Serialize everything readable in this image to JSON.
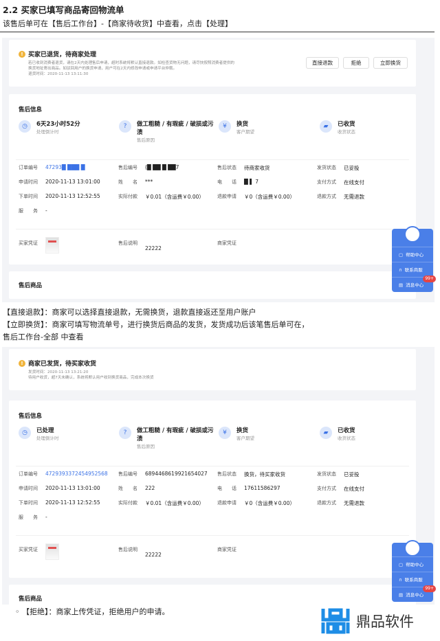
{
  "doc": {
    "heading": "2.2 买家已填写商品寄回物流单",
    "intro": "该售后单可在【售后工作台】-【商家待收货】中查看，点击【处理】",
    "note1": "【直接退款】：商家可以选择直接退款，无需换货，退款直接返还至用户账户",
    "note2": "【立即换货】：商家可填写物流单号，进行换货后商品的发货，发货成功后该笔售后单可在，",
    "note3": "售后工作台-全部  中查看",
    "note4": "◦ 【拒绝】：商家上传凭证，拒绝用户的申请。"
  },
  "logo": {
    "text": "鼎品软件",
    "color": "#1e8de6"
  },
  "accent": "#3b72e6",
  "panels": [
    {
      "alert": {
        "title": "买家已退货，待商家处理",
        "lines": [
          "若已收到消费者退货，请在2天内处理售后申请，超时系统将默认直接退款。如检查货物无问题，请尽快按照消费者提供的",
          "换货地址寄出商品。如驳回用户的换货申请，用户可在2天内修改申请或申请平台仲裁。",
          "退货时间：2020-11-13 13:11:30"
        ],
        "buttons": [
          "直接退款",
          "拒绝",
          "立即换货"
        ]
      },
      "info_title": "售后信息",
      "stats": [
        {
          "icon": "clock-icon",
          "value": "6天23小时52分",
          "label": "处理倒计时"
        },
        {
          "icon": "shield-question-icon",
          "value": "做工粗糙 / 有瑕疵 / 破损或污渍",
          "label": "售后原因"
        },
        {
          "icon": "yen-exchange-icon",
          "value": "换货",
          "label": "客户期望"
        },
        {
          "icon": "truck-icon",
          "value": "已收货",
          "label": "收货状态"
        }
      ],
      "rows": [
        [
          [
            "订单编号",
            "47293█ ███ █"
          ],
          [
            "售后编号",
            "(█  ██ █  ██7"
          ],
          [
            "售后状态",
            "待商家收货"
          ],
          [
            "发货状态",
            "已妥投"
          ]
        ],
        [
          [
            "申请时间",
            "2020-11-13 13:01:00"
          ],
          [
            "姓　　名",
            "***"
          ],
          [
            "电　　话",
            "█ ▌ 7"
          ],
          [
            "支付方式",
            "在线支付"
          ]
        ],
        [
          [
            "下单时间",
            "2020-11-13 12:52:55"
          ],
          [
            "实际付款",
            "￥0.01（含运费￥0.00）"
          ],
          [
            "退款申请",
            "￥0（含运费￥0.00）"
          ],
          [
            "退款方式",
            "无需退款"
          ]
        ],
        [
          [
            "服　　务",
            "-"
          ]
        ]
      ],
      "proof": {
        "buyer_label": "买家凭证",
        "note_label": "售后说明",
        "note_value": "22222",
        "seller_label": "商家凭证"
      },
      "goods_title": "售后商品"
    },
    {
      "alert": {
        "title": "商家已发货，待买家收货",
        "lines": [
          "发货时间：2020-11-13 13:21:20",
          "待用户收货，超7天未确认，系统将默认用户收到换货商品，完成本次换货"
        ],
        "buttons": []
      },
      "info_title": "售后信息",
      "stats": [
        {
          "icon": "clock-icon",
          "value": "已处理",
          "label": "处理倒计时"
        },
        {
          "icon": "shield-question-icon",
          "value": "做工粗糙 / 有瑕疵 / 破损或污渍",
          "label": "售后原因"
        },
        {
          "icon": "yen-exchange-icon",
          "value": "换货",
          "label": "客户期望"
        },
        {
          "icon": "truck-icon",
          "value": "已收货",
          "label": "收货状态"
        }
      ],
      "rows": [
        [
          [
            "订单编号",
            "4729393372454952568"
          ],
          [
            "售后编号",
            "6894468619921654027"
          ],
          [
            "售后状态",
            "换货，待买家收货"
          ],
          [
            "发货状态",
            "已妥投"
          ]
        ],
        [
          [
            "申请时间",
            "2020-11-13 13:01:00"
          ],
          [
            "姓　　名",
            "222"
          ],
          [
            "电　　话",
            "17611586297"
          ],
          [
            "支付方式",
            "在线支付"
          ]
        ],
        [
          [
            "下单时间",
            "2020-11-13 12:52:55"
          ],
          [
            "实际付款",
            "￥0.01（含运费￥0.00）"
          ],
          [
            "退款申请",
            "￥0（含运费￥0.00）"
          ],
          [
            "退款方式",
            "无需退款"
          ]
        ],
        [
          [
            "服　　务",
            "-"
          ]
        ]
      ],
      "proof": {
        "buyer_label": "买家凭证",
        "note_label": "售后说明",
        "note_value": "22222",
        "seller_label": "商家凭证"
      },
      "goods_title": "售后商品"
    }
  ],
  "widget": {
    "items": [
      "帮助中心",
      "联系商服",
      "消息中心"
    ],
    "badge": "99+",
    "icons": [
      "help-book-icon",
      "headset-icon",
      "message-icon"
    ]
  }
}
